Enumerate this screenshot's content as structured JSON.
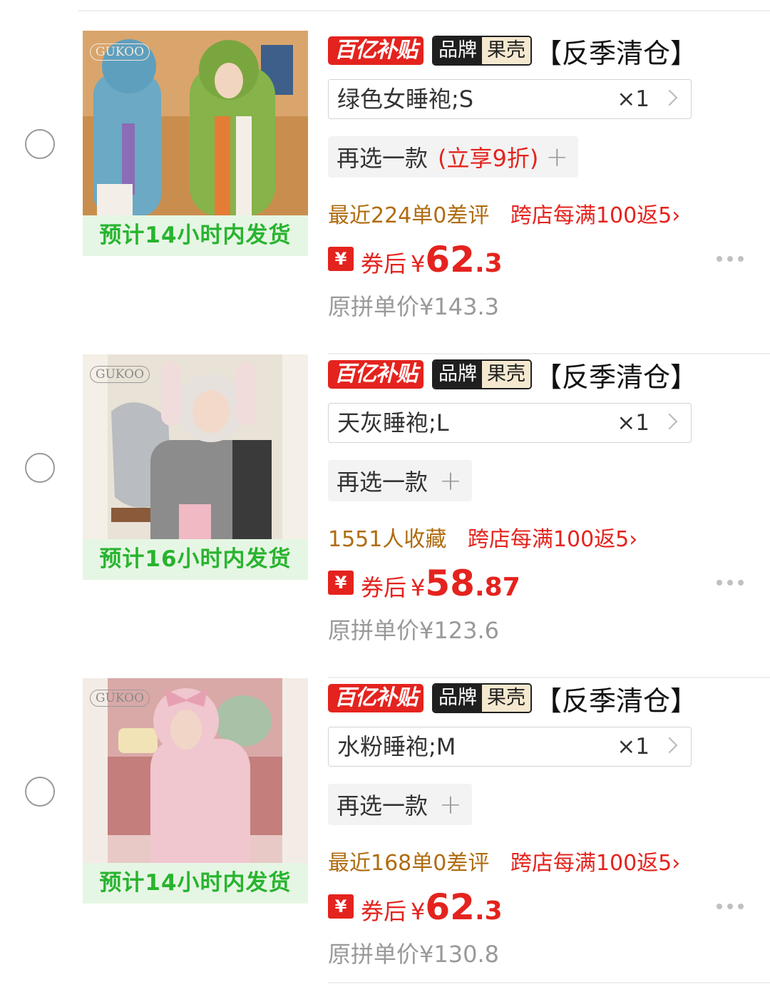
{
  "badges": {
    "subsidy": "百亿补贴",
    "brand_label": "品牌",
    "brand_name": "果壳"
  },
  "items": [
    {
      "title": "【反季清仓】",
      "ship_text": "预计14小时内发货",
      "thumb_logo": "GUKOO",
      "sku_name": "绿色女睡袍;S",
      "qty": "×1",
      "reselect_label": "再选一款",
      "reselect_discount": "(立享9折)",
      "reselect_plus": "+",
      "stat_text": "最近224单0差评",
      "promo_text": "跨店每满100返5›",
      "coupon_icon": "¥",
      "price_label": "券后",
      "price_symbol": "¥",
      "price_int": "62",
      "price_dec": ".3",
      "orig_price": "原拼单价¥143.3"
    },
    {
      "title": "【反季清仓】",
      "ship_text": "预计16小时内发货",
      "thumb_logo": "GUKOO",
      "sku_name": "天灰睡袍;L",
      "qty": "×1",
      "reselect_label": "再选一款",
      "reselect_discount": "",
      "reselect_plus": "+",
      "stat_text": "1551人收藏",
      "promo_text": "跨店每满100返5›",
      "coupon_icon": "¥",
      "price_label": "券后",
      "price_symbol": "¥",
      "price_int": "58",
      "price_dec": ".87",
      "orig_price": "原拼单价¥123.6"
    },
    {
      "title": "【反季清仓】",
      "ship_text": "预计14小时内发货",
      "thumb_logo": "GUKOO",
      "sku_name": "水粉睡袍;M",
      "qty": "×1",
      "reselect_label": "再选一款",
      "reselect_discount": "",
      "reselect_plus": "+",
      "stat_text": "最近168单0差评",
      "promo_text": "跨店每满100返5›",
      "coupon_icon": "¥",
      "price_label": "券后",
      "price_symbol": "¥",
      "price_int": "62",
      "price_dec": ".3",
      "orig_price": "原拼单价¥130.8"
    }
  ],
  "colors": {
    "accent_red": "#e4231e",
    "ship_green": "#28b42f",
    "stat_brown": "#b06c10"
  }
}
